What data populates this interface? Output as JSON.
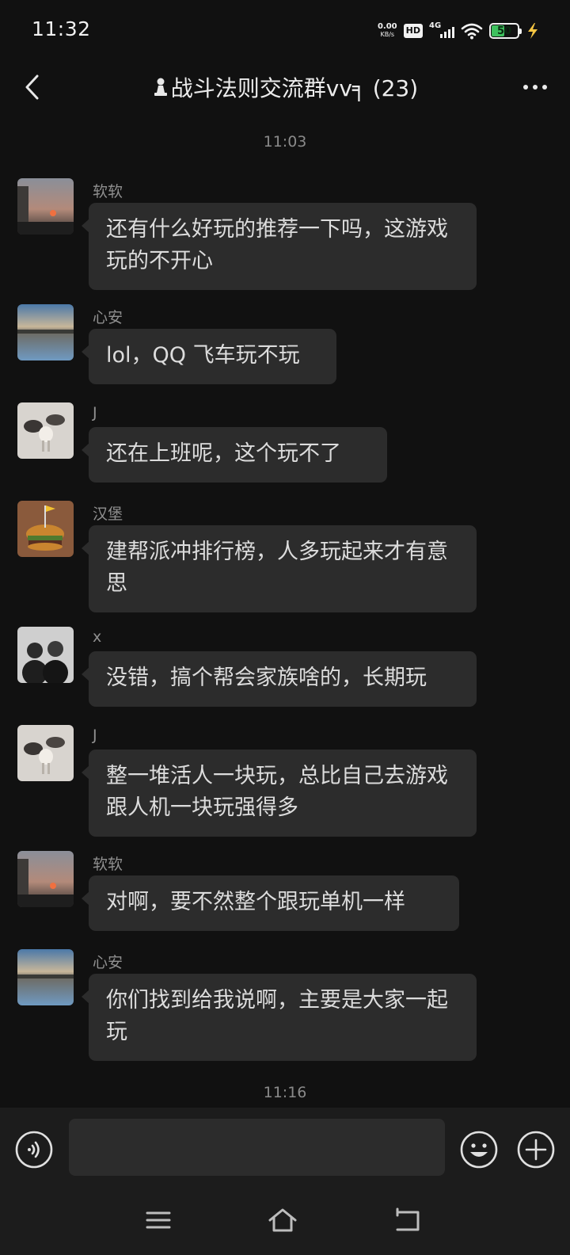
{
  "status_bar": {
    "time": "11:32",
    "net_speed_value": "0.00",
    "net_speed_unit": "KB/s",
    "hd_badge": "HD",
    "network": "4G",
    "battery_level": "50",
    "battery_fraction": 0.5,
    "charging_icon": "bolt-icon"
  },
  "header": {
    "back_icon": "back-chevron-icon",
    "title_icon": "chess-pawn-icon",
    "title": "战斗法则交流群vv╕ (23)",
    "more_icon": "more-dots-icon"
  },
  "chat": {
    "timestamps": [
      "11:03",
      "11:16"
    ],
    "messages": [
      {
        "sender": "软软",
        "text": "还有什么好玩的推荐一下吗，这游戏玩的不开心",
        "avatar": "sunset-avatar"
      },
      {
        "sender": "心安",
        "text": "lol，QQ 飞车玩不玩",
        "avatar": "lake-avatar"
      },
      {
        "sender": "J",
        "text": "还在上班呢，这个玩不了",
        "avatar": "sheep-avatar"
      },
      {
        "sender": "汉堡",
        "text": "建帮派冲排行榜，人多玩起来才有意思",
        "avatar": "burger-avatar"
      },
      {
        "sender": "x",
        "text": "没错，搞个帮会家族啥的，长期玩",
        "avatar": "couple-photo-avatar"
      },
      {
        "sender": "J",
        "text": "整一堆活人一块玩，总比自己去游戏跟人机一块玩强得多",
        "avatar": "sheep-avatar"
      },
      {
        "sender": "软软",
        "text": "对啊，要不然整个跟玩单机一样",
        "avatar": "sunset-avatar"
      },
      {
        "sender": "心安",
        "text": "你们找到给我说啊，主要是大家一起玩",
        "avatar": "lake-avatar"
      }
    ]
  },
  "input_bar": {
    "voice_icon": "voice-input-icon",
    "text_value": "",
    "emoji_icon": "emoji-icon",
    "add_icon": "plus-circle-icon"
  },
  "nav_bar": {
    "menu_icon": "menu-icon",
    "home_icon": "home-icon",
    "back_icon": "back-nav-icon"
  },
  "colors": {
    "background": "#111111",
    "bubble": "#2c2c2c",
    "bar": "#1c1c1c",
    "battery_fill": "#3ec15e"
  }
}
